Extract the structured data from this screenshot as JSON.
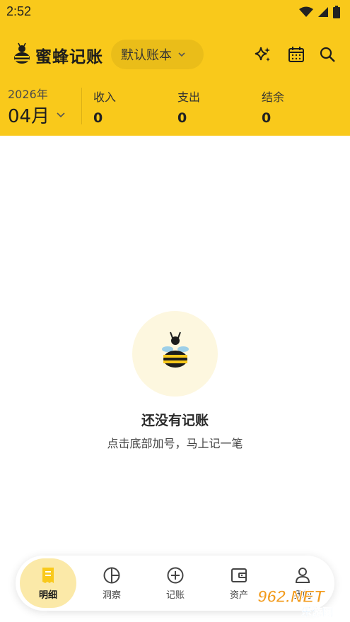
{
  "status_bar": {
    "time": "2:52"
  },
  "app": {
    "title": "蜜蜂记账",
    "book_selector": "默认账本"
  },
  "summary": {
    "year": "2026年",
    "month": "04月",
    "stats": [
      {
        "label": "收入",
        "value": "0"
      },
      {
        "label": "支出",
        "value": "0"
      },
      {
        "label": "结余",
        "value": "0"
      }
    ]
  },
  "empty_state": {
    "title": "还没有记账",
    "subtitle": "点击底部加号，马上记一笔"
  },
  "bottom_nav": {
    "items": [
      {
        "label": "明细",
        "icon": "receipt-icon",
        "active": true
      },
      {
        "label": "洞察",
        "icon": "pie-chart-icon",
        "active": false
      },
      {
        "label": "记账",
        "icon": "plus-circle-icon",
        "active": false
      },
      {
        "label": "资产",
        "icon": "wallet-icon",
        "active": false
      },
      {
        "label": "我的",
        "icon": "person-icon",
        "active": false
      }
    ]
  },
  "watermark": {
    "text": "962.NET",
    "subtext": "乐游网"
  },
  "colors": {
    "brand_yellow": "#f9c91b",
    "active_tab_bg": "#fbe9a8",
    "empty_circle_bg": "#fdf7df"
  }
}
